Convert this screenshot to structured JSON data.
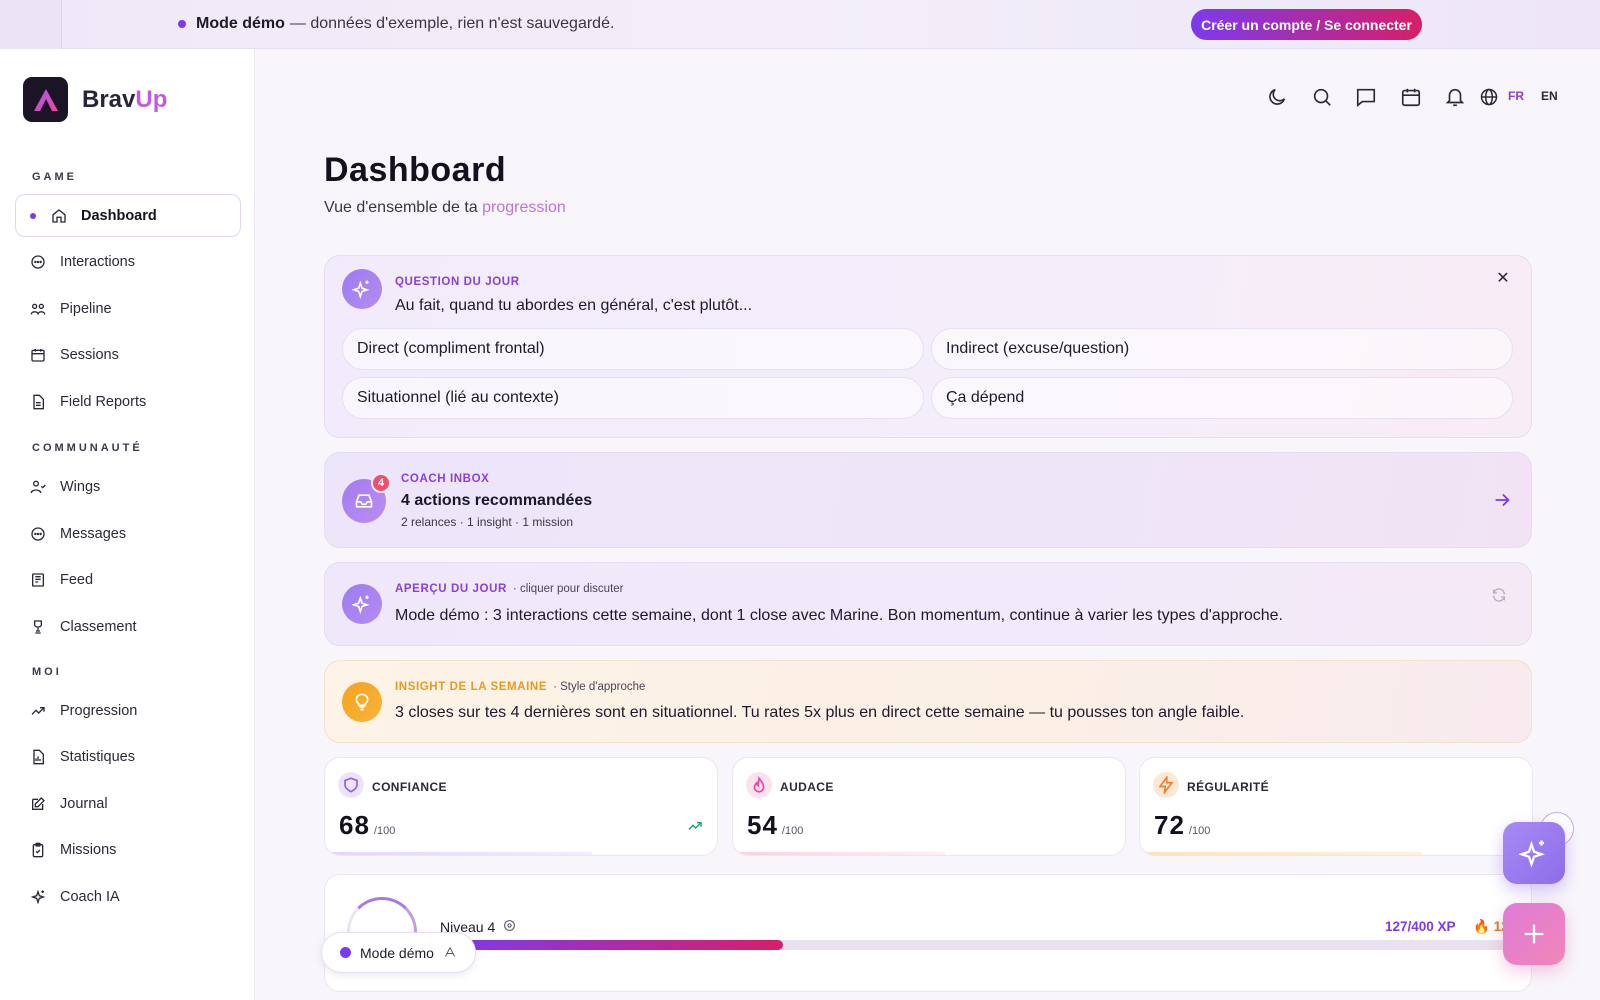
{
  "banner": {
    "title": "Mode démo",
    "message": "— données d'exemple, rien n'est sauvegardé.",
    "cta": "Créer un compte / Se connecter"
  },
  "brand": {
    "name_a": "Brav",
    "name_b": "Up"
  },
  "sidebar": {
    "sections": [
      {
        "label": "GAME"
      },
      {
        "label": "COMMUNAUTÉ"
      },
      {
        "label": "MOI"
      }
    ],
    "items": [
      {
        "label": "Dashboard",
        "icon": "home-icon",
        "active": true
      },
      {
        "label": "Interactions",
        "icon": "chat-bubble-icon"
      },
      {
        "label": "Pipeline",
        "icon": "people-icon"
      },
      {
        "label": "Sessions",
        "icon": "calendar-icon"
      },
      {
        "label": "Field Reports",
        "icon": "document-icon"
      },
      {
        "label": "Wings",
        "icon": "users-icon"
      },
      {
        "label": "Messages",
        "icon": "message-icon"
      },
      {
        "label": "Feed",
        "icon": "newspaper-icon"
      },
      {
        "label": "Classement",
        "icon": "trophy-icon"
      },
      {
        "label": "Progression",
        "icon": "trending-up-icon"
      },
      {
        "label": "Statistiques",
        "icon": "chart-icon"
      },
      {
        "label": "Journal",
        "icon": "edit-icon"
      },
      {
        "label": "Missions",
        "icon": "clipboard-icon"
      },
      {
        "label": "Coach IA",
        "icon": "sparkles-icon"
      }
    ]
  },
  "header": {
    "icons": [
      "moon-icon",
      "search-icon",
      "chat-icon",
      "calendar-icon",
      "bell-icon",
      "globe-icon"
    ],
    "lang_fr": "FR",
    "lang_en": "EN"
  },
  "page": {
    "title": "Dashboard",
    "subtitle_a": "Vue d'ensemble de ta",
    "subtitle_b": "progression"
  },
  "question": {
    "kicker": "QUESTION DU JOUR",
    "text": "Au fait, quand tu abordes en général, c'est plutôt...",
    "options": [
      "Direct (compliment frontal)",
      "Indirect (excuse/question)",
      "Situationnel (lié au contexte)",
      "Ça dépend"
    ]
  },
  "inbox": {
    "kicker": "COACH INBOX",
    "badge": "4",
    "title": "4 actions recommandées",
    "subtitle": "2 relances · 1 insight · 1 mission"
  },
  "apercu": {
    "kicker": "APERÇU DU JOUR",
    "hint": "· cliquer pour discuter",
    "text": "Mode démo : 3 interactions cette semaine, dont 1 close avec Marine. Bon momentum, continue à varier les types d'approche."
  },
  "insight": {
    "kicker": "INSIGHT DE LA SEMAINE",
    "hint": "· Style d'approche",
    "text": "3 closes sur tes 4 dernières sont en situationnel. Tu rates 5x plus en direct cette semaine — tu pousses ton angle faible."
  },
  "stats": [
    {
      "label": "CONFIANCE",
      "value": "68",
      "max": "/100",
      "color": "#8b5cf6",
      "fraction": 0.68
    },
    {
      "label": "AUDACE",
      "value": "54",
      "max": "/100",
      "color": "#ec4899",
      "fraction": 0.54
    },
    {
      "label": "RÉGULARITÉ",
      "value": "72",
      "max": "/100",
      "color": "#f59e0b",
      "fraction": 0.72
    }
  ],
  "level": {
    "label": "Niveau 4",
    "xp": "127/400 XP",
    "streak": "12",
    "progress": 0.3175
  },
  "demo_pill": {
    "label": "Mode démo"
  },
  "colors": {
    "accent": "#7c3aed",
    "accent2": "#d61f69",
    "pink": "#c05ce0"
  }
}
